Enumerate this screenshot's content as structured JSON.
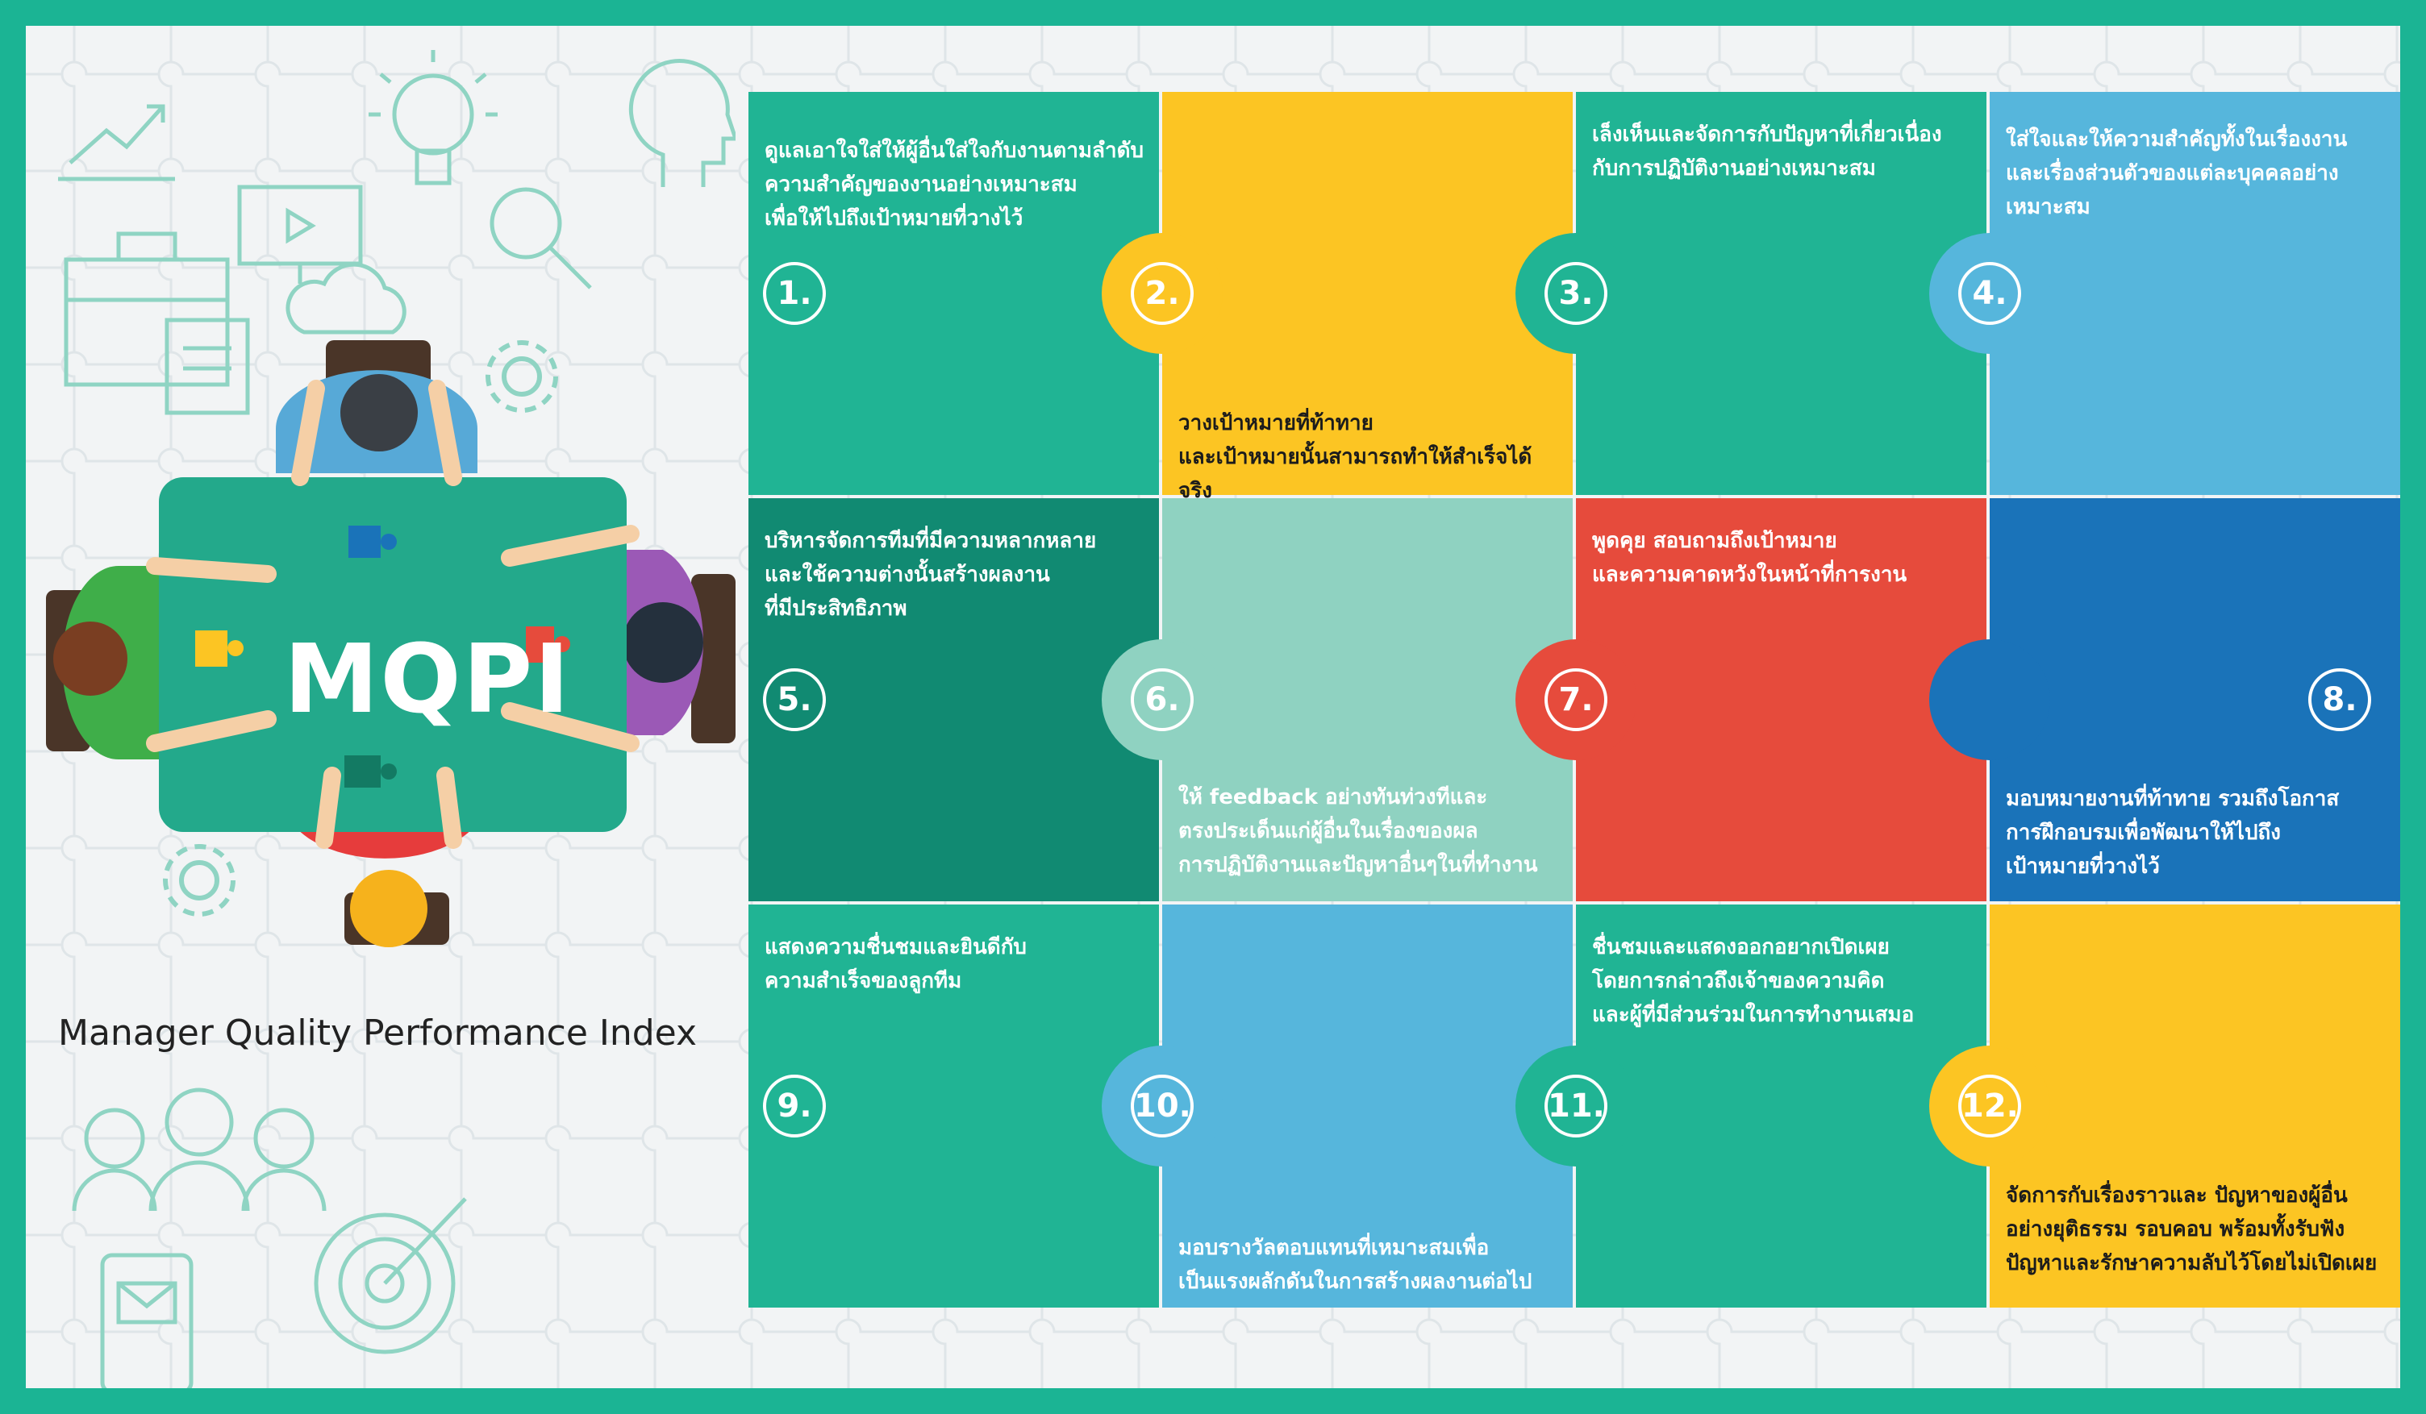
{
  "brand": {
    "logo_text": "MQPI",
    "subtitle": "Manager Quality Performance Index"
  },
  "colors": {
    "frame": "#1bb494",
    "teal": "#20b494",
    "yellow": "#fcc523",
    "light_blue": "#56b6dc",
    "dark_teal": "#118a72",
    "mint": "#8fd2c1",
    "red": "#e64b3c",
    "blue": "#1a73b9",
    "table_green": "#23a98b"
  },
  "cells": [
    {
      "number": "1.",
      "text_lines": [
        "ดูแลเอาใจใส่ให้ผู้อื่นใส่ใจกับงานตามลำดับ",
        "ความสำคัญของงานอย่างเหมาะสม",
        "เพื่อให้ไปถึงเป้าหมายที่วางไว้"
      ],
      "color": "#20b494"
    },
    {
      "number": "2.",
      "text_lines": [
        "วางเป้าหมายที่ท้าทาย",
        "และเป้าหมายนั้นสามารถทำให้สำเร็จได้จริง"
      ],
      "color": "#fcc523"
    },
    {
      "number": "3.",
      "text_lines": [
        "เล็งเห็นและจัดการกับปัญหาที่เกี่ยวเนื่อง",
        "กับการปฏิบัติงานอย่างเหมาะสม"
      ],
      "color": "#20b494"
    },
    {
      "number": "4.",
      "text_lines": [
        "ใส่ใจและให้ความสำคัญทั้งในเรื่องงาน",
        "และเรื่องส่วนตัวของแต่ละบุคคลอย่าง",
        "เหมาะสม"
      ],
      "color": "#56b6dc"
    },
    {
      "number": "5.",
      "text_lines": [
        "บริหารจัดการทีมที่มีความหลากหลาย",
        "และใช้ความต่างนั้นสร้างผลงาน",
        "ที่มีประสิทธิภาพ"
      ],
      "color": "#118a72"
    },
    {
      "number": "6.",
      "text_lines": [
        "ให้ feedback อย่างทันท่วงทีและ",
        "ตรงประเด็นแก่ผู้อื่นในเรื่องของผล",
        "การปฏิบัติงานและปัญหาอื่นๆในที่ทำงาน"
      ],
      "color": "#8fd2c1"
    },
    {
      "number": "7.",
      "text_lines": [
        "พูดคุย สอบถามถึงเป้าหมาย",
        "และความคาดหวังในหน้าที่การงาน"
      ],
      "color": "#e64b3c"
    },
    {
      "number": "8.",
      "text_lines": [
        "มอบหมายงานที่ท้าทาย รวมถึงโอกาส",
        "การฝึกอบรมเพื่อพัฒนาให้ไปถึง",
        "เป้าหมายที่วางไว้"
      ],
      "color": "#1a73b9"
    },
    {
      "number": "9.",
      "text_lines": [
        "แสดงความชื่นชมและยินดีกับ",
        "ความสำเร็จของลูกทีม"
      ],
      "color": "#20b494"
    },
    {
      "number": "10.",
      "text_lines": [
        "มอบรางวัลตอบแทนที่เหมาะสมเพื่อ",
        "เป็นแรงผลักดันในการสร้างผลงานต่อไป"
      ],
      "color": "#56b6dc"
    },
    {
      "number": "11.",
      "text_lines": [
        "ชื่นชมและแสดงออกอยากเปิดเผย",
        "โดยการกล่าวถึงเจ้าของความคิด",
        "และผู้ที่มีส่วนร่วมในการทำงานเสมอ"
      ],
      "color": "#20b494"
    },
    {
      "number": "12.",
      "text_lines": [
        "จัดการกับเรื่องราวและ ปัญหาของผู้อื่น",
        "อย่างยุติธรรม รอบคอบ พร้อมทั้งรับฟัง",
        "ปัญหาและรักษาความลับไว้โดยไม่เปิดเผย"
      ],
      "color": "#fcc523"
    }
  ]
}
